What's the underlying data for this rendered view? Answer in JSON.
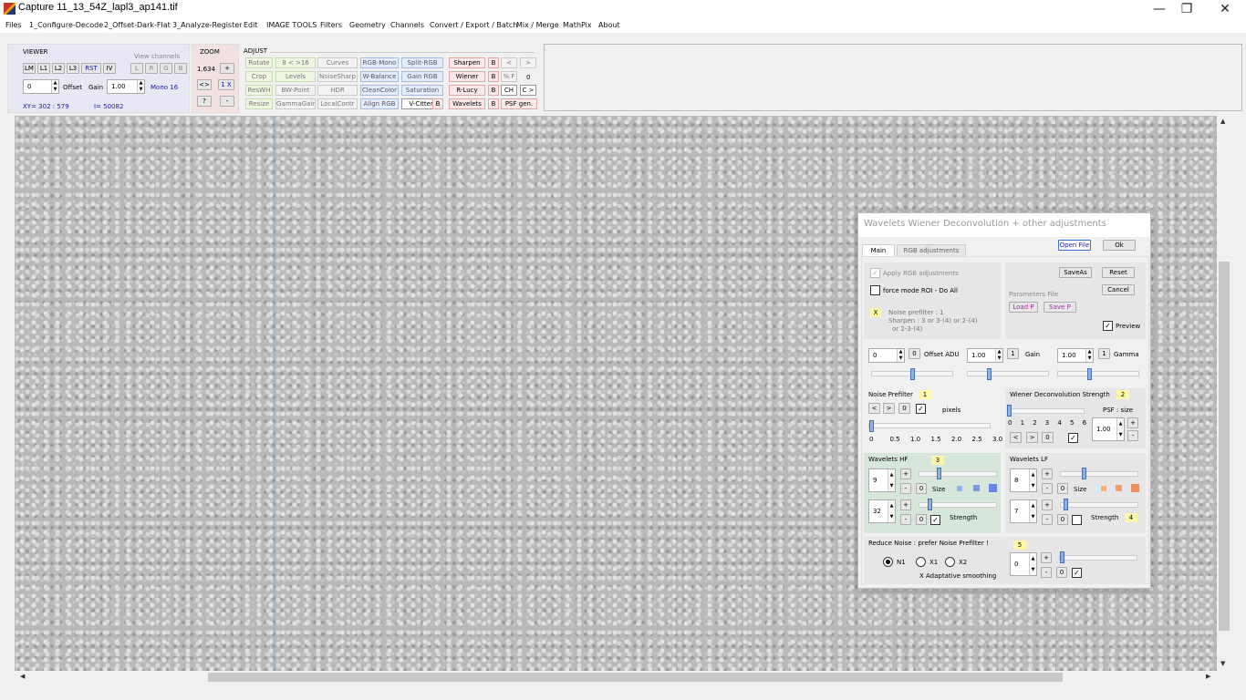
{
  "window": {
    "title": "Capture 11_13_54Z_lapl3_ap141.tif",
    "minimize": "—",
    "maximize": "❐",
    "close": "✕"
  },
  "menu": [
    "Files",
    "1_Configure-Decode",
    "2_Offset-Dark-Flat",
    "3_Analyze-Register",
    "Edit",
    "IMAGE TOOLS",
    "Filters",
    "Geometry",
    "Channels",
    "Convert / Export / Batch",
    "Mix / Merge",
    "MathPix",
    "About"
  ],
  "viewer": {
    "label": "VIEWER",
    "view_channels_label": "View channels",
    "buttons": [
      "LM",
      "L1",
      "L2",
      "L3",
      "RST",
      "IV"
    ],
    "channels": [
      "L",
      "R",
      "G",
      "B"
    ],
    "offset_value": "0",
    "offset_label": "Offset",
    "gain_label": "Gain",
    "gain_value": "1.00",
    "mode": "Mono 16",
    "xy": "XY=  302 : 579",
    "intensity": "I=  50082"
  },
  "zoom": {
    "label": "ZOOM",
    "value": "1.634",
    "plus": "+",
    "fit": "<>",
    "onex": "1 X",
    "help": "?",
    "minus": "-"
  },
  "adjust": {
    "label": "ADJUST",
    "col1": [
      "Rotate",
      "Crop",
      "ResWH",
      "Resize"
    ],
    "col2": [
      "8 < >16",
      "Levels",
      "BW-Point",
      "GammaGain"
    ],
    "col3": [
      "Curves",
      "NoiseSharp",
      "HDR",
      "LocalContr"
    ],
    "col4": [
      "RGB-Mono",
      "W-Balance",
      "CleanColor",
      "Align RGB"
    ],
    "col5": [
      "Split-RGB",
      "Gain RGB",
      "Saturation",
      "V-Cittert"
    ],
    "col6": [
      "Sharpen",
      "Wiener",
      "R-Lucy",
      "Wavelets"
    ],
    "b": "B",
    "nav_prev": "<",
    "nav_next": ">",
    "pctf": "% F",
    "zero": "0",
    "ch": "CH",
    "cnext": "C >",
    "psf": "PSF gen."
  },
  "dialog": {
    "title": "Wavelets Wiener Deconvolution + other adjustments",
    "tab_main": "Main",
    "tab_rgb": "RGB adjustments",
    "open_file": "Open File",
    "ok": "Ok",
    "apply_rgb": "Apply RGB adjustments",
    "force_mode": "force mode  ROI - Do All",
    "saveas": "SaveAs",
    "reset": "Reset",
    "cancel": "Cancel",
    "params_file": "Parameters File",
    "load": "Load P",
    "save": "Save P",
    "preview": "Preview",
    "x_badge": "X",
    "note_line1": "Noise prefilter :  1",
    "note_line2": "Sharpen :  3  or  3-(4)  or  2-(4)",
    "note_line3": "or  2-3-(4)",
    "offset_value": "0",
    "offset_reset": "0",
    "offset_label": "Offset ADU",
    "gain_value": "1.00",
    "gain_reset": "1",
    "gain_label": "Gain",
    "gamma_value": "1.00",
    "gamma_reset": "1",
    "gamma_label": "Gamma",
    "noise_label": "Noise Prefilter",
    "noise_num": "1",
    "lt": "<",
    "gt": ">",
    "zero": "0",
    "pixels": "pixels",
    "noise_ticks": [
      "0",
      "0.5",
      "1.0",
      "1.5",
      "2.0",
      "2.5",
      "3.0"
    ],
    "wiener_label": "Wiener Deconvolution Strength",
    "wiener_num": "2",
    "wiener_ticks": [
      "0",
      "1",
      "2",
      "3",
      "4",
      "5",
      "6"
    ],
    "psf_size": "PSF : size",
    "psf_value": "1.00",
    "whf_label": "Wavelets HF",
    "whf_num": "3",
    "whf_size": "9",
    "whf_strength": "32",
    "size": "Size",
    "strength": "Strength",
    "wlf_label": "Wavelets LF",
    "wlf_size": "8",
    "wlf_strength": "7",
    "wlf_num": "4",
    "reduce_label": "Reduce Noise :  prefer Noise Prefilter !",
    "reduce_num": "5",
    "n1": "N1",
    "x1": "X1",
    "x2": "X2",
    "adaptive": "X Adaptative smoothing",
    "reduce_value": "0",
    "plus": "+",
    "minus": "-"
  },
  "colors": {
    "accent_blue": "#1a1aa0",
    "badge_yellow": "#fff7a8",
    "panel_green": "#d6e6da"
  }
}
